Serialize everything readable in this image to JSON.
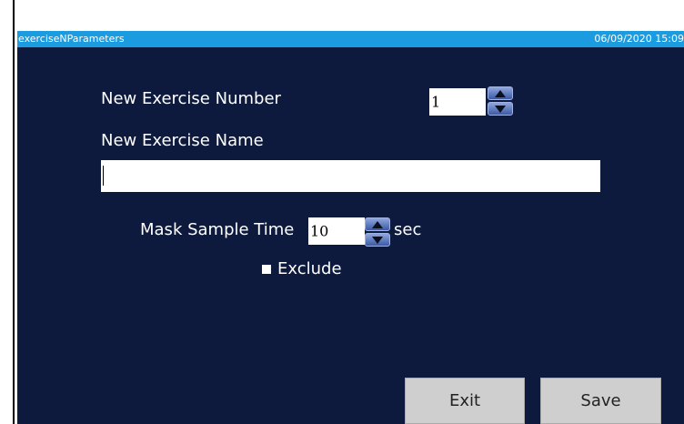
{
  "window": {
    "title": "exerciseNParameters",
    "datetime": "06/09/2020 15:09"
  },
  "form": {
    "exercise_number_label": "New Exercise Number",
    "exercise_number_value": "1",
    "exercise_name_label": "New Exercise Name",
    "exercise_name_value": "",
    "mask_sample_time_label": "Mask Sample Time",
    "mask_sample_time_value": "10",
    "mask_sample_time_unit": "sec",
    "exclude_label": "Exclude",
    "exclude_checked": false
  },
  "buttons": {
    "exit_label": "Exit",
    "save_label": "Save"
  },
  "colors": {
    "background": "#0d1a3e",
    "titlebar": "#1b9be0",
    "button": "#cfcfcf"
  }
}
